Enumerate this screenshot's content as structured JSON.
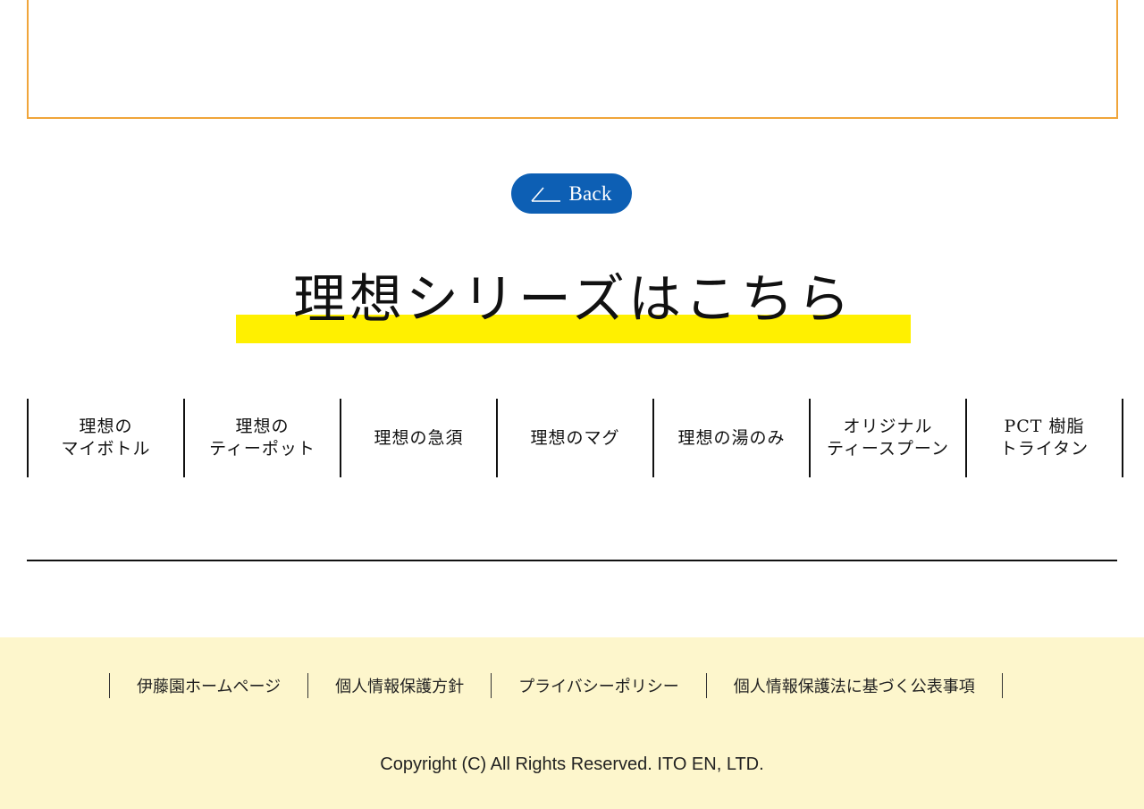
{
  "back_button": {
    "label": "Back",
    "icon": "back-arrow-icon",
    "color": "#0d5fb4"
  },
  "series": {
    "heading": "理想シリーズはこちら",
    "highlight_color": "#fff000",
    "items": [
      {
        "label": "理想の\nマイボトル"
      },
      {
        "label": "理想の\nティーポット"
      },
      {
        "label": "理想の急須"
      },
      {
        "label": "理想のマグ"
      },
      {
        "label": "理想の湯のみ"
      },
      {
        "label": "オリジナル\nティースプーン"
      },
      {
        "label": "PCT 樹脂\nトライタン"
      }
    ]
  },
  "footer": {
    "background": "#fdf6cc",
    "links": [
      {
        "label": "伊藤園ホームページ"
      },
      {
        "label": "個人情報保護方針"
      },
      {
        "label": "プライバシーポリシー"
      },
      {
        "label": "個人情報保護法に基づく公表事項"
      }
    ],
    "copyright": "Copyright (C) All Rights Reserved. ITO EN, LTD."
  },
  "top_box": {
    "border_color": "#f0a53a"
  }
}
